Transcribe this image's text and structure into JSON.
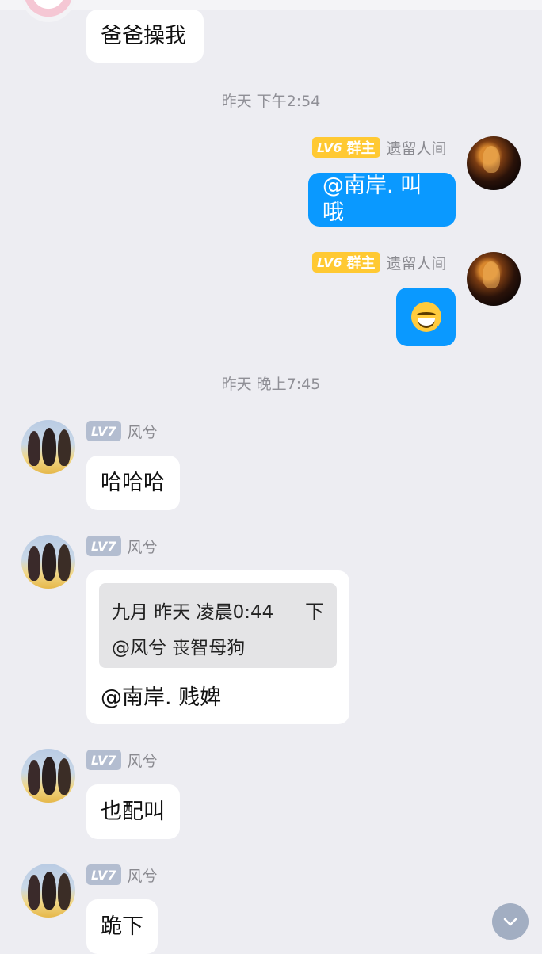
{
  "messages": {
    "m1": {
      "text": "爸爸操我"
    },
    "t1": "昨天 下午2:54",
    "m2": {
      "level": "LV6",
      "role": "群主",
      "name": "遗留人间",
      "text": "@南岸. 叫哦"
    },
    "m3": {
      "level": "LV6",
      "role": "群主",
      "name": "遗留人间",
      "emoji": "grinning-face-emoji"
    },
    "t2": "昨天 晚上7:45",
    "m4": {
      "level": "LV7",
      "name": "风兮",
      "text": "哈哈哈"
    },
    "m5": {
      "level": "LV7",
      "name": "风兮",
      "quote_header": "九月 昨天 凌晨0:44",
      "quote_toggle": "下",
      "quote_body": "@风兮 丧智母狗",
      "text": "@南岸. 贱婢"
    },
    "m6": {
      "level": "LV7",
      "name": "风兮",
      "text": "也配叫"
    },
    "m7": {
      "level": "LV7",
      "name": "风兮",
      "text": "跪下"
    }
  },
  "colors": {
    "bubble_blue": "#0a99ff",
    "badge_gold": "#ffc933",
    "badge_grey": "#b3bdd0",
    "background": "#ededf2"
  },
  "icons": {
    "scroll_down": "chevron-down-icon"
  }
}
